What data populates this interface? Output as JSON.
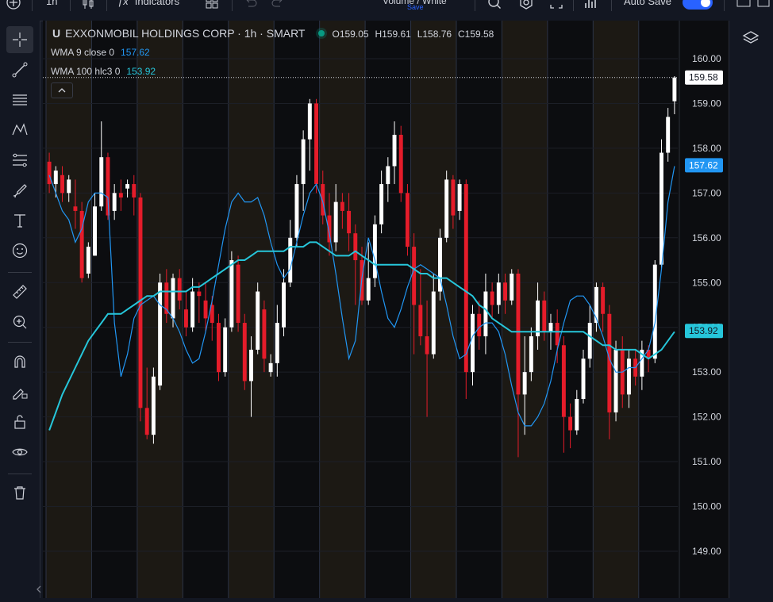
{
  "toolbar": {
    "interval": "1h",
    "indicators_label": "Indicators",
    "layout_name": "Volume / White",
    "save_status": "Save",
    "autosave_label": "Auto Save"
  },
  "legend": {
    "symbol_badge": "U",
    "title": "EXXONMOBIL HOLDINGS CORP · 1h · SMART",
    "ohlc": {
      "open": "O159.05",
      "high": "H159.61",
      "low": "L158.76",
      "close": "C159.58"
    },
    "indicators": [
      {
        "name": "WMA 9 close 0",
        "value": "157.62",
        "color": "#2196f3"
      },
      {
        "name": "WMA 100 hlc3 0",
        "value": "153.92",
        "color": "#26c6da"
      }
    ]
  },
  "colors": {
    "up": "#ffffff",
    "down": "#e51c2a",
    "wma9": "#2196f3",
    "wma100": "#26c6da",
    "background": "#131722",
    "session_band": "#2a2418",
    "accent": "#2962ff"
  },
  "icons": [
    "plus-circle-icon",
    "candles-icon",
    "indicators-icon",
    "templates-icon",
    "undo-icon",
    "redo-icon",
    "search-icon",
    "settings-icon",
    "fullscreen-icon",
    "chart-icon",
    "layers-icon",
    "crosshair-icon",
    "trendline-icon",
    "horizontal-lines-icon",
    "pattern-icon",
    "fib-icon",
    "brush-icon",
    "text-icon",
    "emoji-icon",
    "ruler-icon",
    "zoom-in-icon",
    "magnet-icon",
    "lock-draw-icon",
    "unlock-icon",
    "eye-icon",
    "trash-icon"
  ],
  "chart_data": {
    "type": "candlestick",
    "title": "EXXONMOBIL HOLDINGS CORP · 1h · SMART",
    "ylim": [
      148.5,
      160.6
    ],
    "y_ticks": [
      "160.00",
      "159.00",
      "158.00",
      "157.00",
      "156.00",
      "155.00",
      "154.00",
      "153.00",
      "152.00",
      "151.00",
      "150.00",
      "149.00"
    ],
    "last_price": "159.58",
    "last_price_color": "#ffffff",
    "series": [
      {
        "name": "WMA 9 close 0",
        "type": "line",
        "color": "#2196f3",
        "last_label": "157.62",
        "values": [
          157.4,
          157.0,
          156.6,
          156.4,
          155.9,
          156.2,
          156.8,
          157.0,
          157.0,
          156.9,
          154.1,
          152.9,
          153.4,
          154.2,
          154.5,
          154.6,
          154.7,
          154.5,
          154.4,
          154.2,
          153.9,
          153.5,
          153.2,
          153.3,
          153.9,
          154.6,
          155.4,
          156.2,
          156.8,
          157.0,
          156.8,
          156.8,
          156.9,
          156.5,
          155.9,
          155.4,
          155.1,
          155.3,
          155.9,
          156.5,
          157.0,
          157.2,
          156.8,
          156.1,
          155.2,
          154.2,
          153.3,
          153.7,
          155.1,
          156.0,
          155.5,
          154.8,
          154.2,
          154.0,
          154.4,
          154.9,
          155.3,
          155.4,
          155.3,
          155.2,
          155.1,
          154.5,
          153.8,
          153.3,
          153.4,
          153.8,
          154.0,
          154.1,
          154.1,
          153.9,
          153.4,
          152.7,
          152.1,
          151.8,
          151.8,
          152.0,
          152.3,
          152.8,
          153.5,
          154.1,
          154.6,
          154.7,
          154.7,
          154.5,
          154.2,
          153.8,
          153.3,
          153.0,
          153.0,
          153.1,
          153.1,
          153.3,
          153.5,
          154.1,
          155.3,
          156.8,
          157.6
        ]
      },
      {
        "name": "WMA 100 hlc3 0",
        "type": "line",
        "color": "#26c6da",
        "last_label": "153.92",
        "values": [
          151.7,
          152.1,
          152.5,
          152.8,
          153.1,
          153.4,
          153.7,
          153.9,
          154.1,
          154.3,
          154.3,
          154.3,
          154.4,
          154.5,
          154.6,
          154.7,
          154.7,
          154.8,
          154.8,
          154.8,
          154.8,
          154.8,
          154.9,
          154.9,
          155.0,
          155.1,
          155.2,
          155.3,
          155.4,
          155.5,
          155.5,
          155.6,
          155.7,
          155.7,
          155.7,
          155.7,
          155.7,
          155.8,
          155.8,
          155.8,
          155.9,
          155.9,
          155.8,
          155.7,
          155.6,
          155.6,
          155.6,
          155.7,
          155.6,
          155.5,
          155.4,
          155.4,
          155.4,
          155.4,
          155.4,
          155.4,
          155.3,
          155.2,
          155.2,
          155.1,
          155.1,
          155.1,
          155.0,
          154.9,
          154.8,
          154.7,
          154.5,
          154.4,
          154.2,
          154.1,
          154.0,
          153.9,
          153.9,
          153.9,
          153.9,
          153.9,
          153.9,
          153.9,
          153.9,
          153.9,
          153.9,
          153.9,
          153.9,
          153.8,
          153.7,
          153.6,
          153.6,
          153.5,
          153.5,
          153.5,
          153.5,
          153.4,
          153.3,
          153.4,
          153.5,
          153.7,
          153.9
        ]
      }
    ],
    "candles": [
      [
        157.7,
        157.2,
        157.9,
        157.0
      ],
      [
        157.2,
        157.5,
        157.6,
        156.9
      ],
      [
        157.4,
        157.0,
        157.6,
        156.8
      ],
      [
        157.0,
        157.3,
        157.4,
        156.8
      ],
      [
        156.7,
        156.6,
        157.3,
        156.2
      ],
      [
        156.6,
        155.1,
        156.8,
        155.0
      ],
      [
        155.2,
        155.8,
        155.9,
        155.1
      ],
      [
        155.6,
        156.7,
        157.0,
        155.6
      ],
      [
        156.7,
        157.8,
        158.6,
        156.6
      ],
      [
        157.8,
        156.5,
        157.9,
        156.4
      ],
      [
        156.6,
        157.0,
        157.2,
        156.4
      ],
      [
        157.0,
        156.9,
        157.3,
        156.6
      ],
      [
        157.1,
        157.2,
        157.3,
        156.9
      ],
      [
        157.2,
        156.9,
        157.4,
        156.5
      ],
      [
        156.9,
        152.2,
        157.0,
        151.9
      ],
      [
        152.2,
        151.6,
        153.1,
        151.5
      ],
      [
        151.6,
        152.9,
        153.1,
        151.4
      ],
      [
        152.7,
        155.0,
        155.2,
        152.6
      ],
      [
        155.0,
        154.3,
        155.3,
        154.1
      ],
      [
        154.2,
        155.1,
        155.2,
        154.0
      ],
      [
        155.1,
        154.6,
        155.3,
        154.4
      ],
      [
        154.4,
        154.0,
        154.8,
        153.8
      ],
      [
        154.0,
        154.8,
        155.1,
        153.9
      ],
      [
        154.8,
        154.7,
        155.0,
        154.1
      ],
      [
        154.6,
        154.2,
        155.0,
        153.9
      ],
      [
        154.5,
        154.1,
        154.7,
        153.7
      ],
      [
        154.1,
        153.0,
        154.3,
        152.8
      ],
      [
        153.0,
        154.0,
        154.2,
        152.9
      ],
      [
        154.0,
        155.5,
        155.7,
        153.9
      ],
      [
        155.4,
        154.1,
        155.6,
        153.9
      ],
      [
        154.1,
        152.8,
        154.3,
        152.6
      ],
      [
        152.8,
        153.5,
        153.8,
        152.0
      ],
      [
        153.5,
        154.8,
        155.0,
        153.4
      ],
      [
        154.4,
        153.3,
        154.6,
        153.0
      ],
      [
        153.0,
        153.2,
        153.4,
        152.9
      ],
      [
        153.2,
        154.1,
        154.5,
        152.9
      ],
      [
        154.0,
        155.0,
        155.3,
        153.8
      ],
      [
        155.0,
        156.0,
        156.4,
        154.9
      ],
      [
        156.0,
        157.2,
        157.4,
        155.8
      ],
      [
        157.2,
        158.2,
        158.4,
        156.6
      ],
      [
        158.2,
        159.0,
        159.1,
        157.5
      ],
      [
        159.0,
        157.2,
        159.1,
        157.0
      ],
      [
        157.2,
        156.5,
        157.5,
        156.3
      ],
      [
        156.5,
        155.9,
        157.0,
        155.6
      ],
      [
        155.9,
        156.8,
        157.2,
        155.7
      ],
      [
        156.8,
        156.6,
        157.0,
        156.2
      ],
      [
        156.6,
        156.1,
        157.0,
        155.7
      ],
      [
        156.1,
        155.5,
        156.3,
        154.5
      ],
      [
        155.5,
        154.6,
        155.8,
        154.5
      ],
      [
        154.6,
        155.1,
        155.9,
        154.5
      ],
      [
        155.1,
        156.3,
        156.5,
        154.9
      ],
      [
        156.3,
        157.2,
        157.5,
        156.1
      ],
      [
        157.2,
        157.6,
        157.8,
        156.8
      ],
      [
        157.6,
        158.3,
        158.6,
        157.2
      ],
      [
        158.3,
        157.0,
        158.5,
        156.8
      ],
      [
        157.0,
        155.8,
        157.2,
        155.6
      ],
      [
        155.8,
        154.5,
        156.1,
        153.4
      ],
      [
        154.5,
        153.8,
        155.3,
        153.6
      ],
      [
        153.8,
        153.4,
        154.6,
        152.0
      ],
      [
        153.4,
        154.8,
        155.2,
        153.3
      ],
      [
        154.8,
        156.0,
        156.2,
        154.6
      ],
      [
        156.0,
        157.3,
        157.5,
        155.9
      ],
      [
        157.3,
        156.5,
        157.4,
        156.2
      ],
      [
        156.6,
        157.2,
        157.3,
        156.4
      ],
      [
        157.2,
        153.0,
        157.3,
        152.4
      ],
      [
        153.0,
        154.3,
        154.5,
        152.7
      ],
      [
        154.3,
        153.8,
        154.6,
        153.5
      ],
      [
        153.8,
        154.8,
        155.2,
        153.4
      ],
      [
        154.8,
        154.5,
        155.0,
        154.2
      ],
      [
        154.5,
        155.0,
        155.2,
        154.3
      ],
      [
        155.0,
        154.6,
        155.2,
        154.3
      ],
      [
        154.6,
        155.2,
        155.3,
        154.5
      ],
      [
        155.2,
        152.5,
        155.3,
        151.1
      ],
      [
        152.5,
        153.0,
        153.8,
        151.6
      ],
      [
        153.0,
        153.8,
        154.0,
        152.8
      ],
      [
        153.8,
        154.6,
        155.0,
        153.5
      ],
      [
        154.6,
        153.9,
        154.8,
        153.7
      ],
      [
        153.9,
        154.1,
        154.3,
        153.5
      ],
      [
        154.1,
        153.6,
        154.4,
        153.2
      ],
      [
        153.6,
        152.0,
        153.8,
        151.2
      ],
      [
        152.0,
        151.7,
        152.3,
        151.3
      ],
      [
        151.7,
        152.4,
        152.6,
        151.6
      ],
      [
        152.4,
        153.3,
        153.5,
        152.3
      ],
      [
        153.3,
        154.1,
        154.5,
        153.1
      ],
      [
        154.1,
        154.9,
        155.0,
        153.9
      ],
      [
        154.9,
        154.3,
        155.0,
        153.9
      ],
      [
        154.3,
        152.1,
        154.5,
        151.5
      ],
      [
        152.1,
        153.5,
        153.7,
        151.9
      ],
      [
        153.5,
        152.5,
        153.8,
        152.2
      ],
      [
        152.5,
        153.3,
        153.5,
        152.2
      ],
      [
        153.3,
        152.9,
        153.5,
        152.7
      ],
      [
        152.9,
        153.5,
        153.7,
        152.6
      ],
      [
        153.5,
        153.3,
        153.6,
        153.0
      ],
      [
        153.3,
        155.4,
        155.5,
        153.2
      ],
      [
        155.4,
        157.9,
        158.2,
        155.3
      ],
      [
        157.9,
        158.7,
        158.9,
        157.7
      ],
      [
        159.05,
        159.58,
        159.61,
        158.76
      ]
    ],
    "candle_fields": [
      "open",
      "close",
      "high",
      "low"
    ]
  }
}
